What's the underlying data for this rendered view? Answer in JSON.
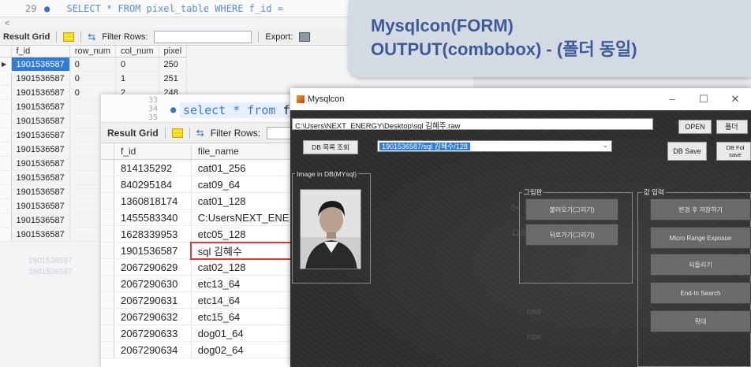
{
  "bench": {
    "line_number": "29",
    "sql_text": "SELECT * FROM pixel_table WHERE f_id =",
    "result_grid_label": "Result Grid",
    "filter_label": "Filter Rows:",
    "export_label": "Export:",
    "columns": [
      "f_id",
      "row_num",
      "col_num",
      "pixel"
    ],
    "rows": [
      [
        "1901536587",
        "0",
        "0",
        "250"
      ],
      [
        "1901536587",
        "0",
        "1",
        "251"
      ],
      [
        "1901536587",
        "0",
        "2",
        "248"
      ],
      [
        "1901536587",
        "",
        "",
        ""
      ],
      [
        "1901536587",
        "",
        "",
        ""
      ],
      [
        "1901536587",
        "",
        "",
        ""
      ],
      [
        "1901536587",
        "",
        "",
        ""
      ],
      [
        "1901536587",
        "",
        "",
        ""
      ],
      [
        "1901536587",
        "",
        "",
        ""
      ],
      [
        "1901536587",
        "",
        "",
        ""
      ],
      [
        "1901536587",
        "",
        "",
        ""
      ],
      [
        "1901536587",
        "",
        "",
        ""
      ],
      [
        "1901536587",
        "",
        "",
        ""
      ]
    ],
    "ghost_rows": [
      "1901536587",
      "1901536587"
    ]
  },
  "mid": {
    "line_numbers": [
      "33",
      "34",
      "35"
    ],
    "query_keyword": "select * from",
    "query_rest": "fi",
    "result_grid_label": "Result Grid",
    "filter_label": "Filter Rows:",
    "columns": [
      "f_id",
      "file_name"
    ],
    "rows": [
      [
        "814135292",
        "cat01_256"
      ],
      [
        "840295184",
        "cat09_64"
      ],
      [
        "1360818174",
        "cat01_128"
      ],
      [
        "1455583340",
        "C:UsersNEXT_ENE"
      ],
      [
        "1628339953",
        "etc05_128"
      ],
      [
        "1901536587",
        "sql 김혜수"
      ],
      [
        "2067290629",
        "cat02_128"
      ],
      [
        "2067290630",
        "etc13_64"
      ],
      [
        "2067290631",
        "etc14_64"
      ],
      [
        "2067290632",
        "etc15_64"
      ],
      [
        "2067290633",
        "dog01_64"
      ],
      [
        "2067290634",
        "dog02_64"
      ]
    ],
    "highlight_row": 5,
    "ghost_raw": "raw",
    "ghost_64": "64"
  },
  "callout": {
    "line1": "Mysqlcon(FORM)",
    "line2": "OUTPUT(combobox) - (폴더 동일)"
  },
  "form": {
    "title": "Mysqlcon",
    "ctrl_minimize": "–",
    "ctrl_maximize": "☐",
    "ctrl_close": "✕",
    "path": "C:\\Users\\NEXT_ENERGY\\Desktop\\sql 김혜주.raw",
    "open_label": "OPEN",
    "folder_label": "폴더",
    "db_list_label": "DB 목록 조회",
    "combo_value": "1901536587/sql 김혜수/128",
    "db_save_label": "DB Save",
    "db_folder_save_label": "DB Fol save",
    "image_group_label": "Image in DB(MYsql)",
    "draw_group_label": "그림판",
    "load_button": "불러오기(그리기)",
    "back_button": "뒤로가기(그리기)",
    "value_group_label": "값 입력",
    "right_buttons": [
      "변경 후 저장하기",
      "Micro Range Exposue",
      "되돌리기",
      "End-In Search",
      "확대"
    ],
    "ghost_texts": [
      "54",
      "128",
      "128"
    ]
  },
  "colors": {
    "accent_blue": "#2f7bd6",
    "callout_text": "#3d5a99",
    "highlight_red": "#e53935"
  }
}
